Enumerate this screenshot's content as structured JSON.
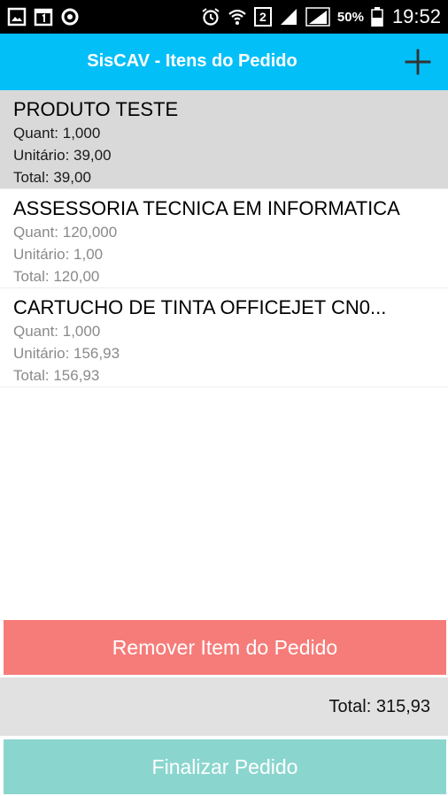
{
  "status_bar": {
    "battery_percent": "50%",
    "time": "19:52",
    "sim_badge": "2",
    "icons": [
      "image-icon",
      "calendar-icon",
      "sync-icon",
      "alarm-icon",
      "wifi-icon",
      "sim-2-icon",
      "signal-icon",
      "signal-icon",
      "battery-icon"
    ]
  },
  "app_bar": {
    "title": "SisCAV - Itens do Pedido",
    "add_icon": "plus-icon",
    "color": "#03bff8"
  },
  "items": [
    {
      "name": "PRODUTO TESTE",
      "quant": "Quant: 1,000",
      "unit": "Unitário: 39,00",
      "total": "Total: 39,00",
      "selected": true
    },
    {
      "name": "ASSESSORIA TECNICA EM INFORMATICA",
      "quant": "Quant: 120,000",
      "unit": "Unitário: 1,00",
      "total": "Total: 120,00",
      "selected": false
    },
    {
      "name": "CARTUCHO DE TINTA OFFICEJET CN0...",
      "quant": "Quant: 1,000",
      "unit": "Unitário: 156,93",
      "total": "Total: 156,93",
      "selected": false
    }
  ],
  "actions": {
    "remove_label": "Remover Item do Pedido",
    "remove_color": "#f67c79",
    "total_label": "Total: 315,93",
    "finalize_label": "Finalizar Pedido",
    "finalize_color": "#8ad6cf"
  }
}
